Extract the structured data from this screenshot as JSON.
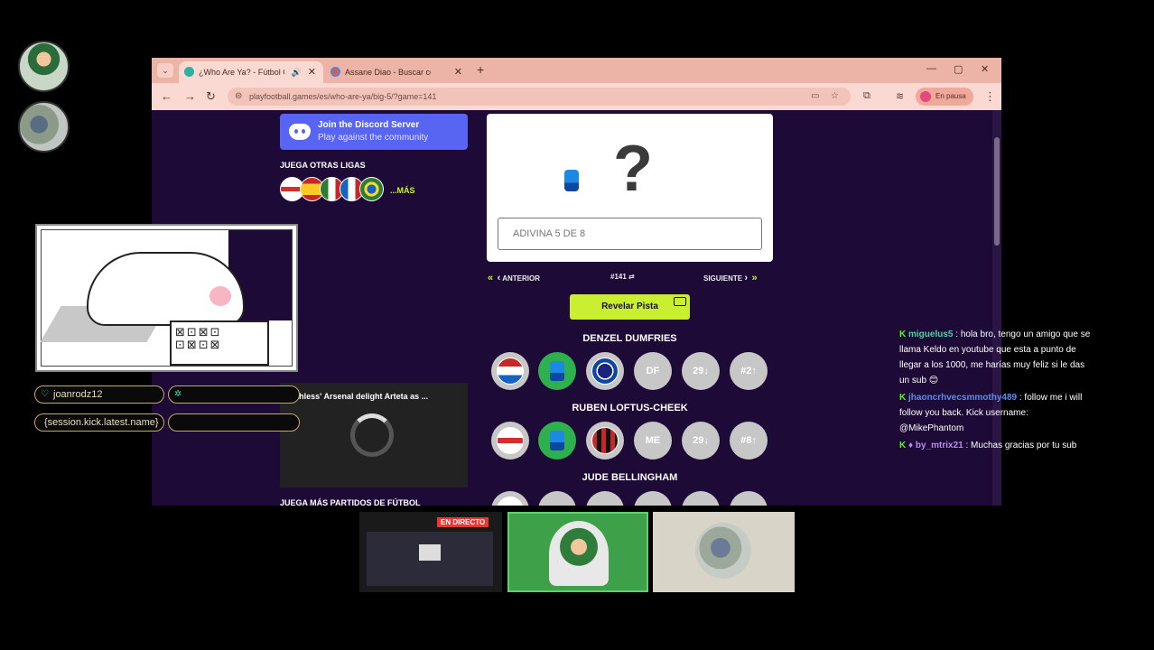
{
  "browser": {
    "tabs": [
      {
        "title": "¿Who Are Ya? - Fútbol Gue",
        "active": true
      },
      {
        "title": "Assane Diao - Buscar con Goo",
        "active": false
      }
    ],
    "url": "playfootball.games/es/who-are-ya/big-5/?game=141",
    "profile_status": "En pausa"
  },
  "sidebar": {
    "discord_title": "Join the Discord Server",
    "discord_subtitle": "Play against the community",
    "leagues_heading": "JUEGA OTRAS LIGAS",
    "more_label": "...MÁS",
    "video_title": "'Ruthless' Arsenal delight Arteta as ...",
    "more_games_heading": "JUEGA MÁS PARTIDOS DE FÚTBOL"
  },
  "game": {
    "mystery_symbol": "?",
    "guess_placeholder": "ADIVINA 5 DE 8",
    "prev_label": "ANTERIOR",
    "game_number": "#141",
    "next_label": "SIGUIENTE",
    "reveal_label": "Revelar Pista",
    "guesses": [
      {
        "name": "DENZEL DUMFRIES",
        "position": "DF",
        "age": "29↓",
        "shirt": "#2↑"
      },
      {
        "name": "RUBEN LOFTUS-CHEEK",
        "position": "ME",
        "age": "29↓",
        "shirt": "#8↑"
      },
      {
        "name": "JUDE BELLINGHAM"
      }
    ]
  },
  "overlay": {
    "pill_user": "joanrodz12",
    "pill_session": "{session.kick.latest.name}",
    "cat_keys": "⊠⊡⊠⊡ ⊡⊠⊡⊠"
  },
  "chat": [
    {
      "user": "miguelus5",
      "text": ": hola bro, tengo un amigo que se llama Keldo en youtube que esta a punto de llegar a los 1000, me harías muy feliz si le das un sub 😊"
    },
    {
      "user": "jhaoncrhvecsmmothy489",
      "text": ": follow me i will follow you back. Kick username: @MikePhantom"
    },
    {
      "user": "by_mtrix21",
      "text": ": Muchas gracias por tu sub"
    }
  ],
  "thumbnails": {
    "live_label": "EN DIRECTO"
  },
  "colors": {
    "page_bg": "#1d0a37",
    "accent": "#c8f030",
    "discord": "#5865f2",
    "match_green": "#2eb04f",
    "neutral": "#c7c7c7",
    "kick_green": "#53fc18"
  }
}
